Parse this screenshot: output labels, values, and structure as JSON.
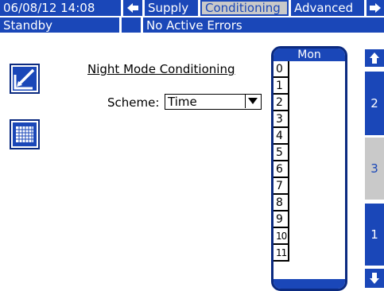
{
  "header": {
    "datetime": "06/08/12 14:08",
    "nav_left_icon": "arrow-left-icon",
    "tabs": [
      {
        "label": "Supply",
        "selected": false
      },
      {
        "label": "Conditioning",
        "selected": true
      },
      {
        "label": "Advanced",
        "selected": false
      }
    ],
    "nav_right_icon": "arrow-right-icon",
    "status": "Standby",
    "errors": "No Active Errors"
  },
  "sidebar": {
    "edit_icon": "edit-icon",
    "calendar_icon": "calendar-icon"
  },
  "main": {
    "title": "Night Mode Conditioning",
    "scheme_label": "Scheme:",
    "scheme_value": "Time"
  },
  "schedule": {
    "day": "Mon",
    "hours": [
      "0",
      "1",
      "2",
      "3",
      "4",
      "5",
      "6",
      "7",
      "8",
      "9",
      "10",
      "11"
    ]
  },
  "pager": {
    "up_icon": "arrow-up-icon",
    "pages": [
      "2",
      "3",
      "1"
    ],
    "current_page": "3",
    "down_icon": "arrow-down-icon"
  },
  "colors": {
    "accent": "#1a47b8",
    "selected_tab_bg": "#c9c9c9",
    "background": "#ffffff"
  }
}
